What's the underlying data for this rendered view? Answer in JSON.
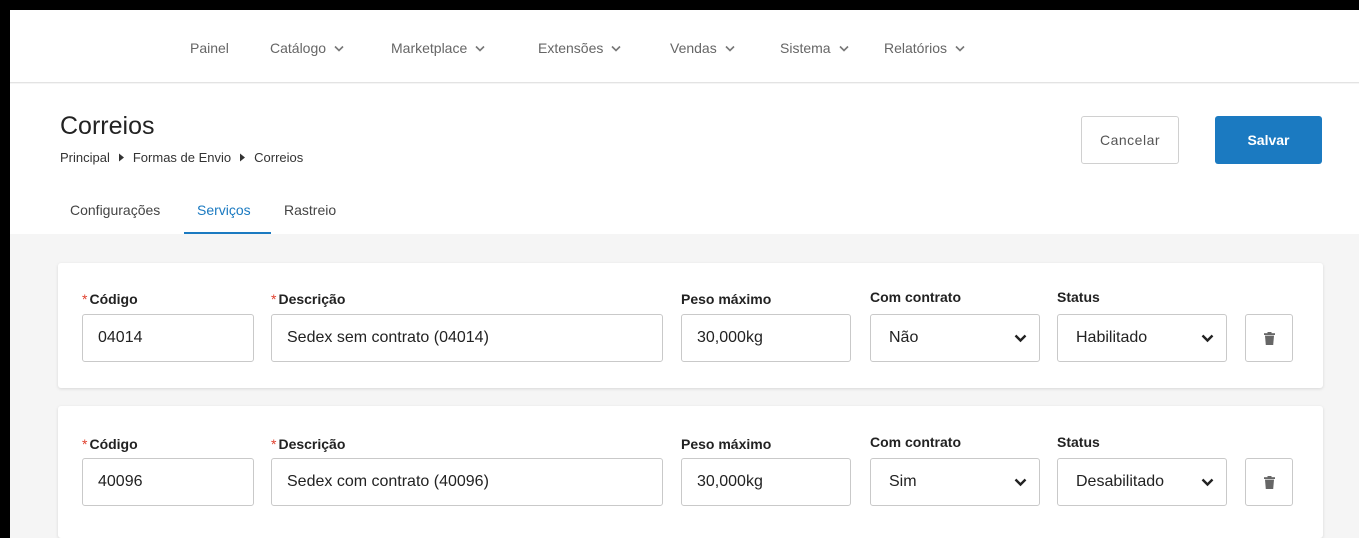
{
  "nav": {
    "items": [
      {
        "label": "Painel",
        "dropdown": false
      },
      {
        "label": "Catálogo",
        "dropdown": true
      },
      {
        "label": "Marketplace",
        "dropdown": true
      },
      {
        "label": "Extensões",
        "dropdown": true
      },
      {
        "label": "Vendas",
        "dropdown": true
      },
      {
        "label": "Sistema",
        "dropdown": true
      },
      {
        "label": "Relatórios",
        "dropdown": true
      }
    ]
  },
  "header": {
    "title": "Correios",
    "breadcrumb": [
      "Principal",
      "Formas de Envio",
      "Correios"
    ],
    "cancel_label": "Cancelar",
    "save_label": "Salvar"
  },
  "tabs": [
    {
      "label": "Configurações",
      "active": false
    },
    {
      "label": "Serviços",
      "active": true
    },
    {
      "label": "Rastreio",
      "active": false
    }
  ],
  "labels": {
    "required_mark": "*",
    "codigo": "Código",
    "descricao": "Descrição",
    "peso": "Peso máximo",
    "contrato": "Com contrato",
    "status": "Status"
  },
  "services": [
    {
      "codigo": "04014",
      "descricao": "Sedex sem contrato (04014)",
      "peso": "30,000kg",
      "contrato": "Não",
      "status": "Habilitado"
    },
    {
      "codigo": "40096",
      "descricao": "Sedex com contrato (40096)",
      "peso": "30,000kg",
      "contrato": "Sim",
      "status": "Desabilitado"
    }
  ],
  "colors": {
    "accent": "#1b7ac1",
    "required": "#e0402e"
  },
  "icons": {
    "delete": "trash-icon",
    "dropdown": "chevron-down-icon"
  }
}
